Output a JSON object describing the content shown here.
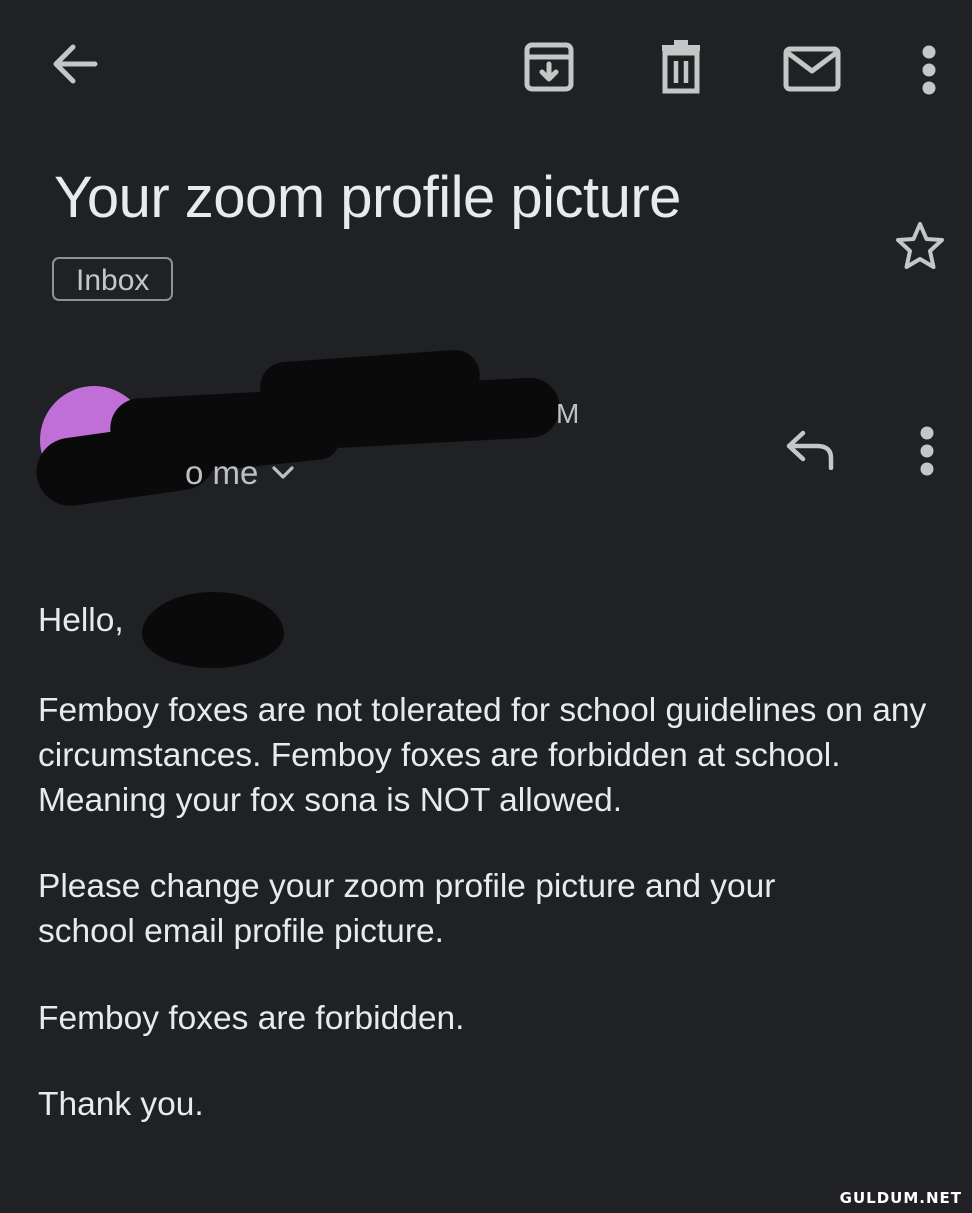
{
  "toolbar": {
    "back_icon": "arrow-left-icon",
    "archive_icon": "archive-icon",
    "delete_icon": "trash-icon",
    "mark_unread_icon": "mail-icon",
    "more_icon": "more-vert-icon"
  },
  "email": {
    "subject": "Your zoom profile picture",
    "label": "Inbox",
    "star_icon": "star-outline-icon",
    "sender": {
      "visible_tail": "M",
      "avatar_color": "#c06fd6"
    },
    "recipient_text": "o me",
    "expand_icon": "chevron-down-icon",
    "reply_icon": "reply-icon",
    "more_icon": "more-vert-icon",
    "greeting": "Hello,",
    "paragraphs": [
      "Femboy foxes are not tolerated for school guidelines on any circumstances. Femboy foxes are forbidden at school. Meaning your fox sona is NOT allowed.",
      "Please change your zoom profile picture and your school email profile picture.",
      "Femboy foxes are forbidden.",
      "Thank you."
    ]
  },
  "watermark": "GULDUM.NET",
  "colors": {
    "background": "#202124",
    "text": "#e8eaed",
    "icon": "#c4c7c5"
  }
}
